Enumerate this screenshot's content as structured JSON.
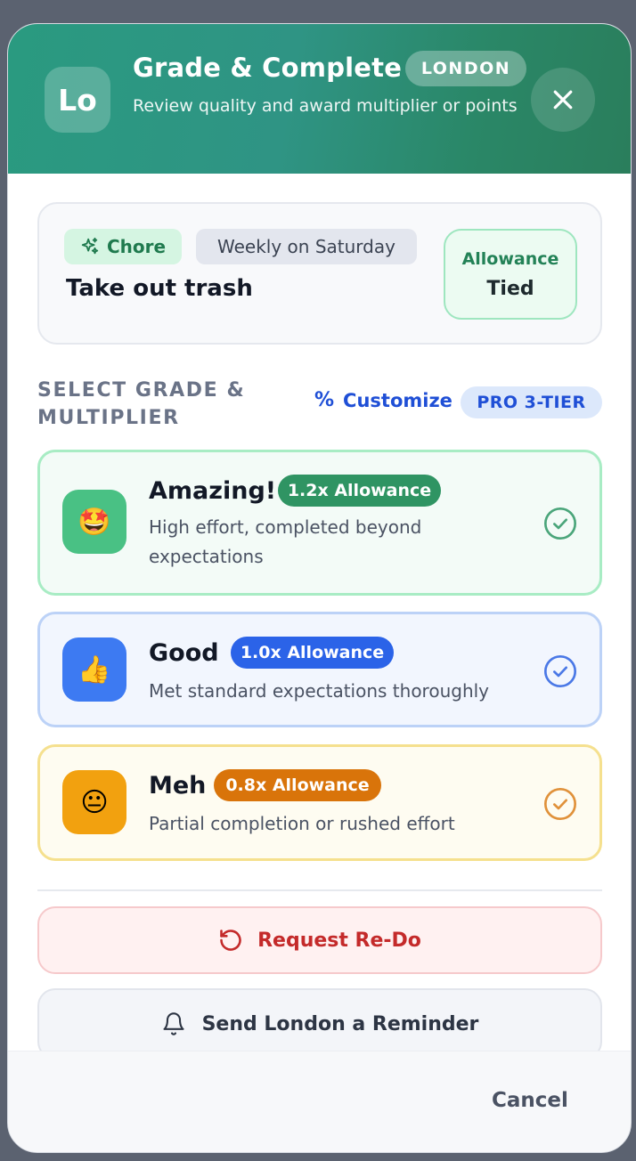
{
  "header": {
    "avatar_initials": "Lo",
    "title": "Grade & Complete",
    "badge": "LONDON",
    "subtitle": "Review quality and award multiplier or points",
    "close_icon": "close-icon"
  },
  "task": {
    "category": "Chore",
    "category_icon": "sparkles-icon",
    "schedule": "Weekly on Saturday",
    "name": "Take out trash",
    "allowance_label": "Allowance",
    "allowance_value": "Tied"
  },
  "grades_section": {
    "label": "SELECT GRADE & MULTIPLIER",
    "customize_label": "Customize",
    "customize_icon": "percent-icon",
    "pro_badge": "PRO 3-TIER"
  },
  "grades": [
    {
      "title": "Amazing!",
      "multiplier": "1.2x Allowance",
      "description": "High effort, completed beyond expectations",
      "emoji": "🤩",
      "accent": "#2f9463"
    },
    {
      "title": "Good",
      "multiplier": "1.0x Allowance",
      "description": "Met standard expectations thoroughly",
      "emoji": "👍",
      "accent": "#2b63e8"
    },
    {
      "title": "Meh",
      "multiplier": "0.8x Allowance",
      "description": "Partial completion or rushed effort",
      "emoji": "😐",
      "accent": "#d9740a"
    }
  ],
  "actions": {
    "redo_label": "Request Re-Do",
    "redo_icon": "rotate-ccw-icon",
    "reminder_label": "Send London a Reminder",
    "reminder_icon": "bell-icon"
  },
  "footer": {
    "cancel_label": "Cancel"
  }
}
